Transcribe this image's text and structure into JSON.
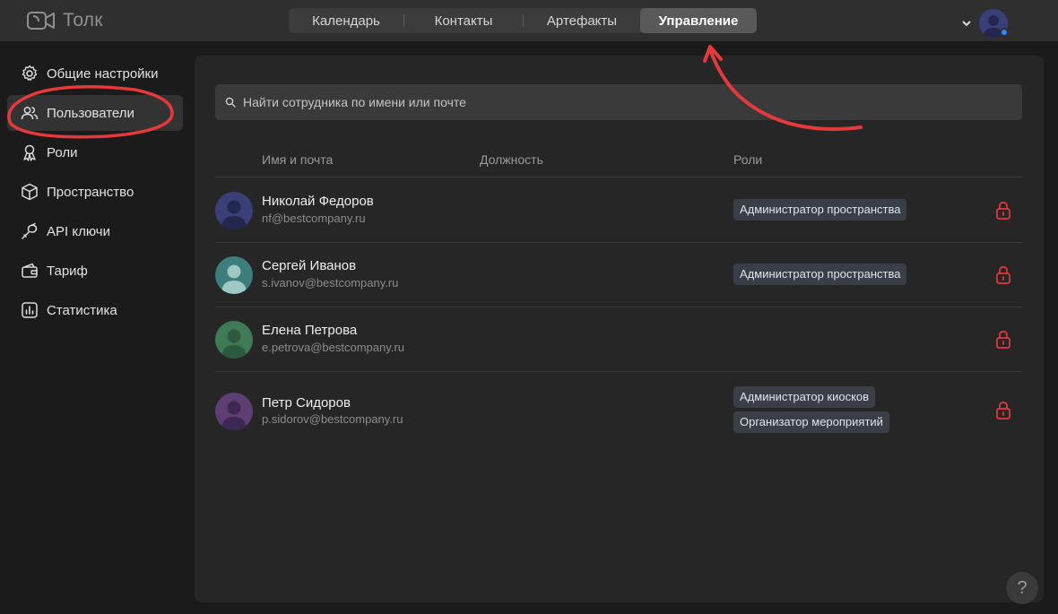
{
  "app": {
    "title": "Толк"
  },
  "nav": {
    "tabs": [
      {
        "label": "Календарь"
      },
      {
        "label": "Контакты"
      },
      {
        "label": "Артефакты"
      },
      {
        "label": "Управление",
        "active": true
      }
    ]
  },
  "sidebar": {
    "items": [
      {
        "label": "Общие настройки",
        "icon": "gear-icon"
      },
      {
        "label": "Пользователи",
        "icon": "users-icon",
        "active": true
      },
      {
        "label": "Роли",
        "icon": "roles-icon"
      },
      {
        "label": "Пространство",
        "icon": "cube-icon"
      },
      {
        "label": "API ключи",
        "icon": "key-icon"
      },
      {
        "label": "Тариф",
        "icon": "wallet-icon"
      },
      {
        "label": "Статистика",
        "icon": "chart-icon"
      }
    ]
  },
  "search": {
    "placeholder": "Найти сотрудника по имени или почте"
  },
  "table": {
    "headers": {
      "name": "Имя и почта",
      "position": "Должность",
      "roles": "Роли"
    },
    "rows": [
      {
        "name": "Николай Федоров",
        "email": "nf@bestcompany.ru",
        "roles": [
          "Администратор пространства"
        ],
        "avatar_color": "#3b3f78"
      },
      {
        "name": "Сергей Иванов",
        "email": "s.ivanov@bestcompany.ru",
        "roles": [
          "Администратор пространства"
        ],
        "avatar_color": "#3e7d7d"
      },
      {
        "name": "Елена Петрова",
        "email": "e.petrova@bestcompany.ru",
        "roles": [],
        "avatar_color": "#3e7a55"
      },
      {
        "name": "Петр Сидоров",
        "email": "p.sidorov@bestcompany.ru",
        "roles": [
          "Администратор киосков",
          "Организатор мероприятий"
        ],
        "avatar_color": "#5d3f74"
      }
    ]
  },
  "help": {
    "label": "?"
  },
  "colors": {
    "accent": "#2f86ff",
    "annotation": "#e5393b",
    "lock": "#e5393b"
  }
}
